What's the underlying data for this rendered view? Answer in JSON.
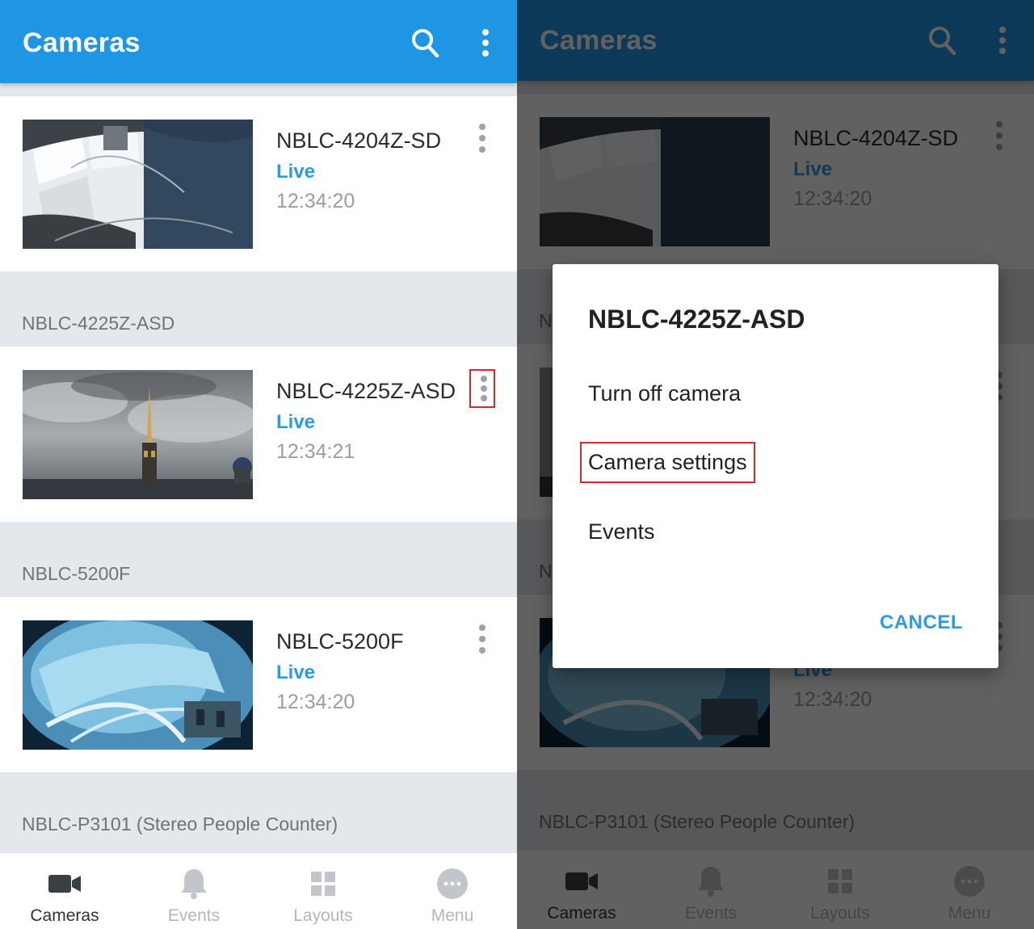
{
  "app_bar": {
    "title": "Cameras"
  },
  "camera_list": [
    {
      "header": "",
      "name": "NBLC-4204Z-SD",
      "status": "Live",
      "time": "12:34:20"
    },
    {
      "header": "NBLC-4225Z-ASD",
      "name": "NBLC-4225Z-ASD",
      "status": "Live",
      "time": "12:34:21"
    },
    {
      "header": "NBLC-5200F",
      "name": "NBLC-5200F",
      "status": "Live",
      "time": "12:34:20"
    }
  ],
  "trailing_group_header": "NBLC-P3101 (Stereo People Counter)",
  "bottom_nav": [
    {
      "label": "Cameras",
      "icon": "video-camera-icon",
      "active": true
    },
    {
      "label": "Events",
      "icon": "bell-icon",
      "active": false
    },
    {
      "label": "Layouts",
      "icon": "grid-icon",
      "active": false
    },
    {
      "label": "Menu",
      "icon": "more-horizontal-icon",
      "active": false
    }
  ],
  "dialog": {
    "title": "NBLC-4225Z-ASD",
    "items": [
      "Turn off camera",
      "Camera settings",
      "Events"
    ],
    "highlighted_item": "Camera settings",
    "cancel_label": "CANCEL"
  },
  "colors": {
    "primary": "#1e96e4",
    "live_status": "#2b9be4",
    "highlight_box": "#d42a2a",
    "group_header_bg": "#e4e7ec"
  }
}
